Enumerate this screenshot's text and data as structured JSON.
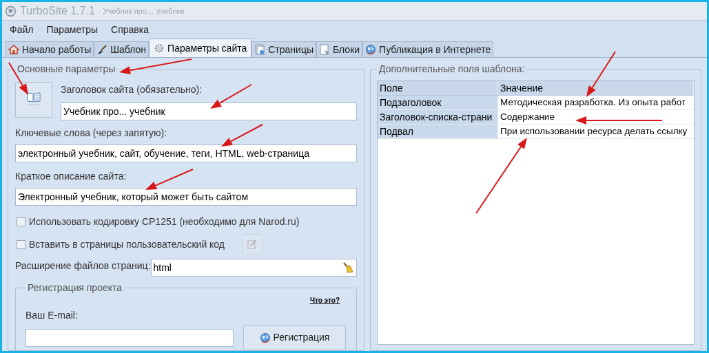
{
  "window": {
    "title": "TurboSite 1.7.1",
    "subtitle": "- Учебник про… учебник"
  },
  "menu": [
    "Файл",
    "Параметры",
    "Справка"
  ],
  "tabs": [
    {
      "label": "Начало работы",
      "kind": "home",
      "selected": false
    },
    {
      "label": "Шаблон",
      "kind": "brush",
      "selected": false
    },
    {
      "label": "Параметры сайта",
      "kind": "gear",
      "selected": true
    },
    {
      "label": "Страницы",
      "kind": "pages",
      "selected": false
    },
    {
      "label": "Блоки",
      "kind": "block",
      "selected": false
    },
    {
      "label": "Публикация в Интернете",
      "kind": "globe",
      "selected": false
    }
  ],
  "main_params": {
    "legend": "Основные параметры",
    "title_field": {
      "label": "Заголовок сайта (обязательно):",
      "value": "Учебник про... учебник"
    },
    "keywords_field": {
      "label": "Ключевые слова (через запятую):",
      "value": "электронный учебник, сайт, обучение, теги, HTML, web-страница"
    },
    "description_field": {
      "label": "Краткое описание сайта:",
      "value": "Электронный учебник, который может быть сайтом"
    },
    "checkboxes": [
      {
        "label": "Использовать кодировку CP1251 (необходимо для Narod.ru)",
        "checked": false
      },
      {
        "label": "Вставить в страницы пользовательский код",
        "checked": false
      }
    ],
    "extension_field": {
      "label": "Расширение файлов страниц:",
      "value": "html"
    },
    "registration": {
      "legend": "Регистрация проекта",
      "help_link": "Что это?",
      "email_label": "Ваш E-mail:",
      "button": "Регистрация"
    }
  },
  "template_fields": {
    "legend": "Дополнительные поля шаблона:",
    "columns": [
      "Поле",
      "Значение"
    ],
    "rows": [
      {
        "field": "Подзаголовок",
        "value": "Методическая разработка. Из опыта работ"
      },
      {
        "field": "Заголовок-списка-страни",
        "value": "Содержание"
      },
      {
        "field": "Подвал",
        "value": "При использовании ресурса делать ссылку"
      }
    ]
  }
}
